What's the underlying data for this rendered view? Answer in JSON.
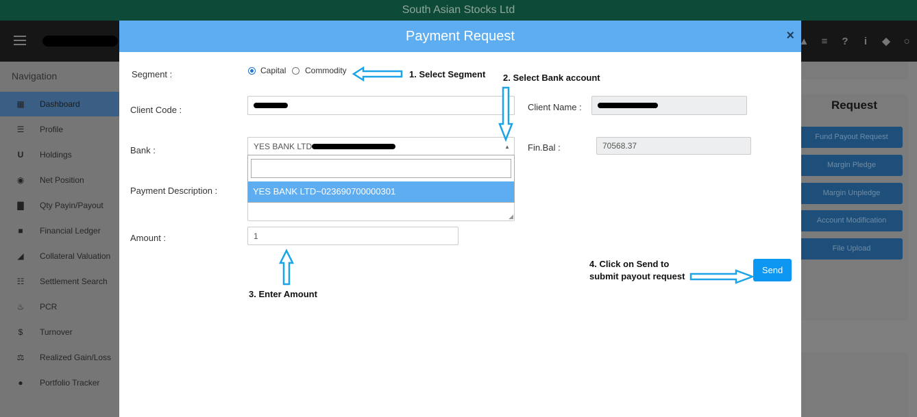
{
  "app": {
    "title": "South Asian Stocks Ltd"
  },
  "sidebar": {
    "title": "Navigation",
    "items": [
      {
        "label": "Dashboard",
        "icon": "dashboard-icon",
        "active": true
      },
      {
        "label": "Profile",
        "icon": "list-icon"
      },
      {
        "label": "Holdings",
        "icon": "holdings-icon"
      },
      {
        "label": "Net Position",
        "icon": "circle-icon"
      },
      {
        "label": "Qty Payin/Payout",
        "icon": "bar-chart-icon"
      },
      {
        "label": "Financial Ledger",
        "icon": "book-icon"
      },
      {
        "label": "Collateral Valuation",
        "icon": "area-chart-icon"
      },
      {
        "label": "Settlement Search",
        "icon": "list-detail-icon"
      },
      {
        "label": "PCR",
        "icon": "fire-icon"
      },
      {
        "label": "Turnover",
        "icon": "dollar-icon"
      },
      {
        "label": "Realized Gain/Loss",
        "icon": "scale-icon"
      },
      {
        "label": "Portfolio Tracker",
        "icon": "map-pin-icon"
      }
    ]
  },
  "right_panel": {
    "title": "Request",
    "buttons": [
      "Fund Payout Request",
      "Margin Pledge",
      "Margin Unpledge",
      "Account Modification",
      "File Upload"
    ]
  },
  "modal": {
    "title": "Payment Request",
    "close": "×",
    "segment": {
      "label": "Segment :",
      "options": [
        "Capital",
        "Commodity"
      ],
      "selected": "Capital"
    },
    "client_code": {
      "label": "Client Code :"
    },
    "client_name": {
      "label": "Client Name :"
    },
    "bank": {
      "label": "Bank :",
      "value_prefix": "YES BANK LTD",
      "option": "YES BANK LTD~023690700000301"
    },
    "fin_bal": {
      "label": "Fin.Bal :",
      "value": "70568.37"
    },
    "payment_description": {
      "label": "Payment Description :"
    },
    "amount": {
      "label": "Amount :",
      "value": "1"
    },
    "send_label": "Send"
  },
  "annotations": {
    "step1": "1. Select Segment",
    "step2": "2. Select Bank account",
    "step3": "3. Enter Amount",
    "step4_line1": "4. Click on Send to",
    "step4_line2": "submit payout request"
  },
  "colors": {
    "accent": "#5fadf1",
    "send": "#0d96f2",
    "arrow": "#1aa3e6",
    "topbar": "#0e4a38"
  }
}
